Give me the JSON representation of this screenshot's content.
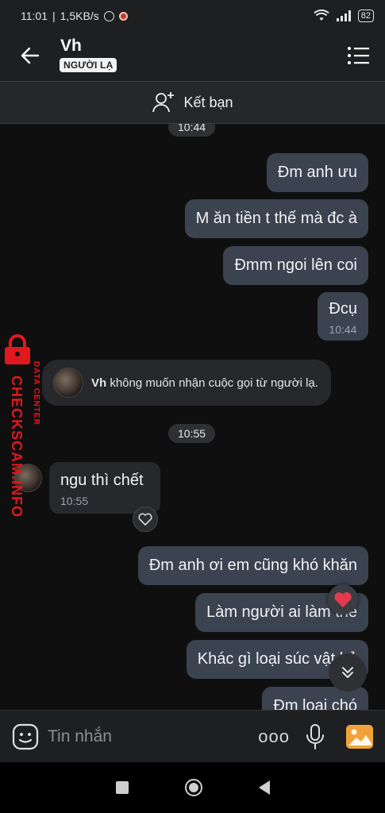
{
  "status_bar": {
    "time": "11:01",
    "speed": "1,5KB/s",
    "battery": "82"
  },
  "header": {
    "contact_name": "Vh",
    "stranger_badge": "NGƯỜI LẠ"
  },
  "friend_bar": {
    "label": "Kết bạn"
  },
  "chat": {
    "top_time": "10:44",
    "outgoing_1": [
      "Đm anh ưu",
      "M ăn tiền t thế mà đc à",
      "Đmm ngoi lên coi"
    ],
    "last_outgoing": {
      "text": "Đcụ",
      "time": "10:44"
    },
    "system_message": {
      "name": "Vh",
      "text": "không muốn nhận cuộc gọi từ người lạ."
    },
    "time_pill": "10:55",
    "incoming": {
      "text": "ngu thì chết",
      "time": "10:55"
    },
    "outgoing_2": [
      "Đm anh ơi em cũng khó khăn",
      "Làm người ai làm thế",
      "Khác gì loại súc vật hả",
      "Đm loại chó"
    ]
  },
  "watermark": {
    "line1": "CHECKSCAM.INFO",
    "line2": "DATA CENTER"
  },
  "composer": {
    "placeholder": "Tin nhắn",
    "more": "ooo"
  },
  "icons": {
    "back": "arrow-left-icon",
    "menu": "list-menu-icon",
    "add_friend": "add-user-icon",
    "sticker": "sticker-icon",
    "mic": "microphone-icon",
    "photo": "image-icon"
  },
  "colors": {
    "outgoing_bubble": "#3b4350",
    "incoming_bubble": "#26282b",
    "heart": "#e53950",
    "photo_icon": "#f0a23a",
    "watermark": "#e0191e"
  }
}
